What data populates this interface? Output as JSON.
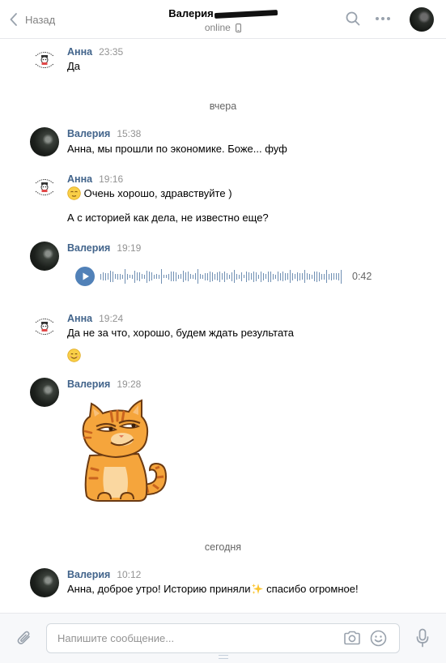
{
  "header": {
    "back_label": "Назад",
    "title": "Валерия",
    "status": "online"
  },
  "dividers": {
    "yesterday": "вчера",
    "today": "сегодня"
  },
  "messages": [
    {
      "author": "Анна",
      "time": "23:35",
      "text": "Да"
    },
    {
      "author": "Валерия",
      "time": "15:38",
      "text": "Анна, мы прошли по экономике. Боже... фуф"
    },
    {
      "author": "Анна",
      "time": "19:16",
      "text": "Очень хорошо, здравствуйте )",
      "text2": "А с историей как дела, не известно еще?"
    },
    {
      "author": "Валерия",
      "time": "19:19",
      "voice_duration": "0:42"
    },
    {
      "author": "Анна",
      "time": "19:24",
      "text": "Да не за что, хорошо, будем ждать результата"
    },
    {
      "author": "Валерия",
      "time": "19:28",
      "attachment": "sticker-ginger-cat"
    },
    {
      "author": "Валерия",
      "time": "10:12",
      "text": "Анна, доброе утро! Историю приняли",
      "text_after": "спасибо огромное!"
    }
  ],
  "composer": {
    "placeholder": "Напишите сообщение..."
  },
  "icons": {
    "back": "chevron-left-icon",
    "search": "search-icon",
    "more": "more-dots-icon",
    "phone": "mobile-phone-icon",
    "attach": "paperclip-icon",
    "camera": "camera-icon",
    "smile": "smile-icon",
    "mic": "microphone-icon"
  },
  "colors": {
    "accent": "#5181b8",
    "author_name": "#42648b",
    "muted": "#828282",
    "sticker_orange": "#f5a53c"
  }
}
